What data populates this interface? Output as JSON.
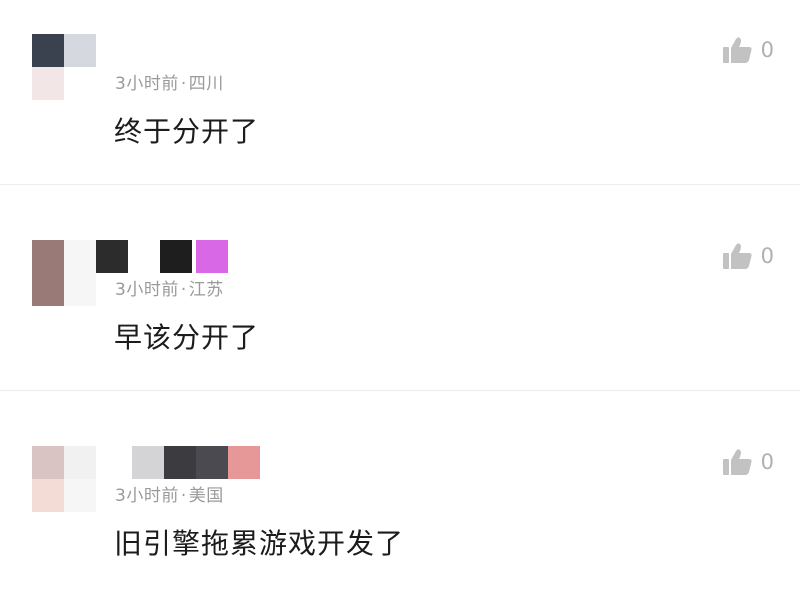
{
  "comments": [
    {
      "time": "3小时前",
      "location": "四川",
      "text": "终于分开了",
      "likes": "0"
    },
    {
      "time": "3小时前",
      "location": "江苏",
      "text": "早该分开了",
      "likes": "0"
    },
    {
      "time": "3小时前",
      "location": "美国",
      "text": "旧引擎拖累游戏开发了",
      "likes": "0"
    }
  ],
  "separator": "·",
  "colors": {
    "meta": "#9a9a9a",
    "text": "#1c1c1c",
    "like": "#c2c2c2",
    "divider": "#ececec"
  },
  "icons": {
    "like": "thumbs-up-icon"
  }
}
